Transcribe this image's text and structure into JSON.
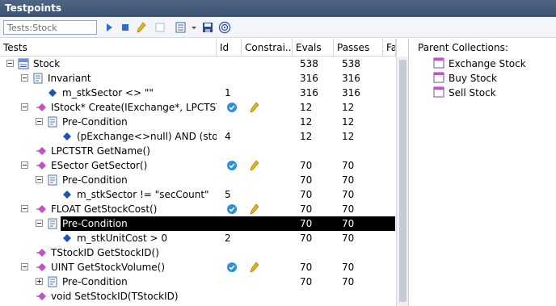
{
  "window": {
    "title": "Testpoints"
  },
  "toolbar": {
    "filter_value": "Tests:Stock",
    "buttons": [
      "run-icon",
      "stop-icon",
      "pencil-icon",
      "checkbox-icon",
      "grid-menu-icon",
      "save-icon",
      "target-icon"
    ]
  },
  "columns": {
    "tests": "Tests",
    "id": "Id",
    "constraints": "Constrai...",
    "evals": "Evals",
    "passes": "Passes",
    "fa": "Fa"
  },
  "rows": [
    {
      "name": "Stock",
      "id": "",
      "evals": "538",
      "passes": "538"
    },
    {
      "name": "Invariant",
      "id": "",
      "evals": "316",
      "passes": "316"
    },
    {
      "name": "m_stkSector <> \"\"",
      "id": "1",
      "evals": "316",
      "passes": "316"
    },
    {
      "name": "IStock* Create(IExchange*, LPCTSTR, F",
      "id": "",
      "evals": "12",
      "passes": "12"
    },
    {
      "name": "Pre-Condition",
      "id": "",
      "evals": "12",
      "passes": "12"
    },
    {
      "name": "(pExchange<>null) AND (stock",
      "id": "4",
      "evals": "12",
      "passes": "12"
    },
    {
      "name": "LPCTSTR GetName()",
      "id": "",
      "evals": "",
      "passes": ""
    },
    {
      "name": "ESector GetSector()",
      "id": "",
      "evals": "70",
      "passes": "70"
    },
    {
      "name": "Pre-Condition",
      "id": "",
      "evals": "70",
      "passes": "70"
    },
    {
      "name": "m_stkSector != \"secCount\"",
      "id": "5",
      "evals": "70",
      "passes": "70"
    },
    {
      "name": "FLOAT GetStockCost()",
      "id": "",
      "evals": "70",
      "passes": "70"
    },
    {
      "name": "Pre-Condition",
      "id": "",
      "evals": "70",
      "passes": "70"
    },
    {
      "name": "m_stkUnitCost > 0",
      "id": "2",
      "evals": "70",
      "passes": "70"
    },
    {
      "name": "TStockID GetStockID()",
      "id": "",
      "evals": "",
      "passes": ""
    },
    {
      "name": "UINT GetStockVolume()",
      "id": "",
      "evals": "70",
      "passes": "70"
    },
    {
      "name": "Pre-Condition",
      "id": "",
      "evals": "70",
      "passes": "70"
    },
    {
      "name": "void SetStockID(TStockID)",
      "id": "",
      "evals": "",
      "passes": ""
    }
  ],
  "parent_collections": {
    "title": "Parent Collections:",
    "items": [
      "Exchange Stock",
      "Buy Stock",
      "Sell Stock"
    ]
  },
  "colors": {
    "titlebar": "#45597a",
    "selection": "#000000",
    "operation_icon": "#c54fc5",
    "constraint_icon": "#1e52b8",
    "check_icon": "#2d8fd5",
    "pencil_icon": "#e3b616"
  }
}
